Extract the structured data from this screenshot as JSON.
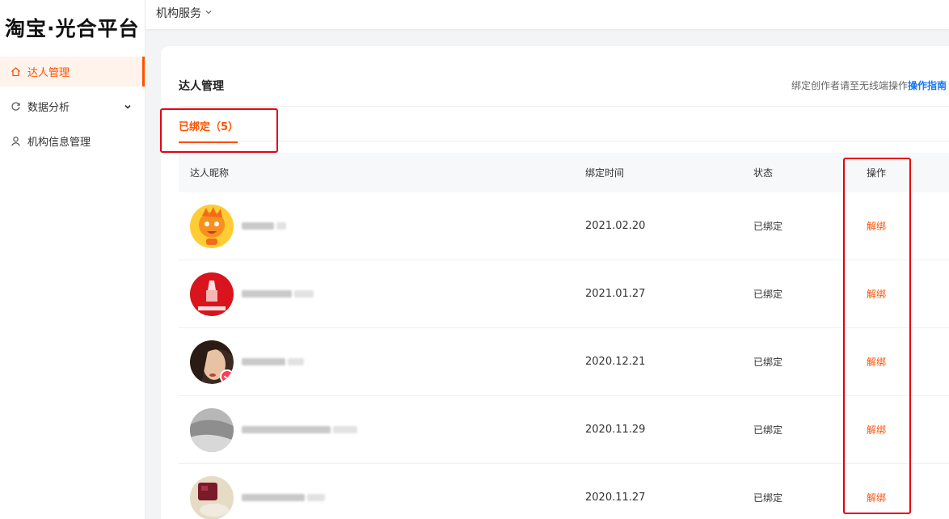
{
  "sidebar": {
    "logo": "淘宝·光合平台",
    "items": [
      {
        "label": "达人管理",
        "icon": "home-icon",
        "active": true
      },
      {
        "label": "数据分析",
        "icon": "refresh-icon",
        "expandable": true
      },
      {
        "label": "机构信息管理",
        "icon": "user-icon"
      }
    ]
  },
  "topbar": {
    "service_label": "机构服务"
  },
  "main": {
    "title": "达人管理",
    "hint_text": "绑定创作者请至无线端操作",
    "hint_link": "操作指南",
    "tab_label": "已绑定（5）",
    "columns": [
      "达人昵称",
      "绑定时间",
      "状态",
      "操作"
    ],
    "rows": [
      {
        "avatar": "cartoon-flame-avatar",
        "bind_time": "2021.02.20",
        "status": "已绑定",
        "action": "解绑"
      },
      {
        "avatar": "red-logo-avatar",
        "bind_time": "2021.01.27",
        "status": "已绑定",
        "action": "解绑"
      },
      {
        "avatar": "woman-photo-avatar",
        "bind_time": "2020.12.21",
        "status": "已绑定",
        "action": "解绑"
      },
      {
        "avatar": "gray-photo-avatar",
        "bind_time": "2020.11.29",
        "status": "已绑定",
        "action": "解绑"
      },
      {
        "avatar": "product-photo-avatar",
        "bind_time": "2020.11.27",
        "status": "已绑定",
        "action": "解绑"
      }
    ]
  },
  "colors": {
    "accent": "#ff5000",
    "link": "#1677ff",
    "highlight_box": "#e60012"
  }
}
